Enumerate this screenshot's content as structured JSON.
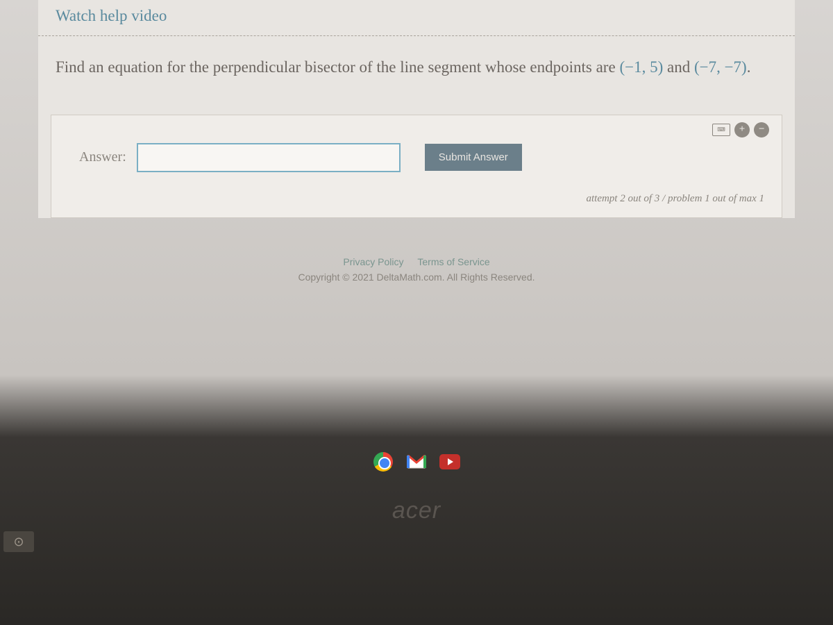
{
  "header": {
    "watch_link": "Watch help video"
  },
  "question": {
    "text_before": "Find an equation for the perpendicular bisector of the line segment whose endpoints are ",
    "coord1": "(−1, 5)",
    "and": " and ",
    "coord2": "(−7, −7)",
    "period": "."
  },
  "answer": {
    "label": "Answer:",
    "value": "",
    "submit_label": "Submit Answer",
    "attempt_status": "attempt 2 out of 3 / problem 1 out of max 1"
  },
  "footer": {
    "privacy": "Privacy Policy",
    "terms": "Terms of Service",
    "copyright": "Copyright © 2021 DeltaMath.com. All Rights Reserved."
  },
  "brand": "acer",
  "camera_badge": "⊙"
}
